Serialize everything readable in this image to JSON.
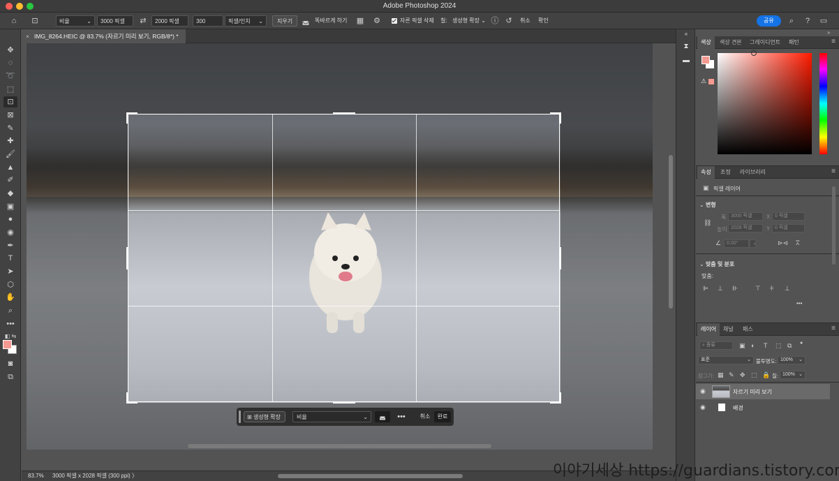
{
  "app": {
    "title": "Adobe Photoshop 2024"
  },
  "options": {
    "ratio_select": "비율",
    "width": "3000 픽셀",
    "height": "2000 픽셀",
    "resolution": "300",
    "resolution_unit": "픽셀/인치",
    "clear": "지우기",
    "straighten": "똑바르게 하기",
    "delete_cropped": "자른 픽셀 삭제",
    "fill_label": "칠:",
    "fill_value": "생성형 확장",
    "cancel": "취소",
    "commit": "확인",
    "share": "공유"
  },
  "document": {
    "tab_title": "IMG_8264.HEIC @ 83.7% (자르기 미리 보기, RGB/8*) *"
  },
  "contextual": {
    "generative_expand": "생성형 확장",
    "ratio": "비율",
    "cancel": "취소",
    "done": "완료"
  },
  "status": {
    "zoom": "83.7%",
    "dimensions": "3000 픽셀 x 2028 픽셀 (300 ppi)",
    "arrow": "〉"
  },
  "color_panel": {
    "tabs": [
      "색상",
      "색상 견본",
      "그레이디언트",
      "패턴"
    ]
  },
  "properties_panel": {
    "tabs": [
      "속성",
      "조정",
      "라이브러리"
    ],
    "layer_type": "픽셀 레이어",
    "transform_header": "변형",
    "w_label": "폭",
    "w_value": "3000 픽셀",
    "x_label": "X",
    "x_value": "0 픽셀",
    "h_label": "높이",
    "h_value": "2028 픽셀",
    "y_label": "Y",
    "y_value": "0 픽셀",
    "angle_value": "0.00°",
    "align_header": "맞춤 및 분포",
    "align_label": "맞춤:",
    "more": "•••"
  },
  "layers_panel": {
    "tabs": [
      "레이어",
      "채널",
      "패스"
    ],
    "filter_kind": "종류",
    "blend_mode": "표준",
    "opacity_label": "불투명도:",
    "opacity_value": "100%",
    "lock_label": "잠그기:",
    "fill_label": "칠:",
    "fill_value": "100%",
    "layers": [
      {
        "name": "자르기 미리 보기",
        "selected": true
      },
      {
        "name": "배경",
        "selected": false
      }
    ]
  },
  "watermark": "이야기세상 https://guardians.tistory.com"
}
